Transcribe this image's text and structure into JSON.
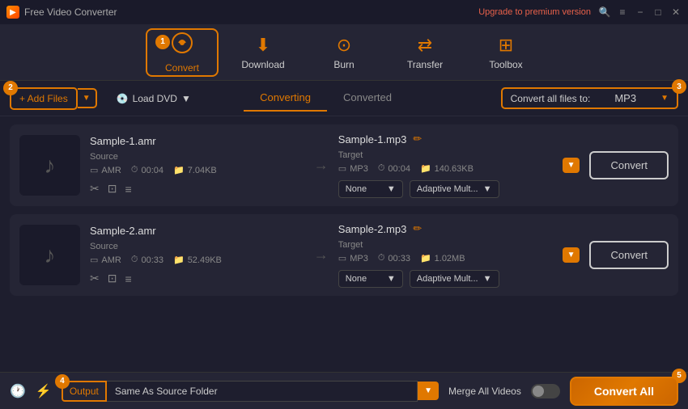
{
  "titlebar": {
    "title": "Free Video Converter",
    "upgrade_text": "Upgrade to premium version",
    "icon": "▶"
  },
  "toolbar": {
    "items": [
      {
        "id": "convert",
        "label": "Convert",
        "icon": "↻",
        "badge": "1",
        "active": true
      },
      {
        "id": "download",
        "label": "Download",
        "icon": "⬇",
        "active": false
      },
      {
        "id": "burn",
        "label": "Burn",
        "icon": "⊙",
        "active": false
      },
      {
        "id": "transfer",
        "label": "Transfer",
        "icon": "⇄",
        "active": false
      },
      {
        "id": "toolbox",
        "label": "Toolbox",
        "icon": "⊞",
        "active": false
      }
    ]
  },
  "subtoolbar": {
    "add_files_label": "+ Add Files",
    "load_dvd_label": "Load DVD",
    "tabs": [
      {
        "label": "Converting",
        "active": true
      },
      {
        "label": "Converted",
        "active": false
      }
    ],
    "convert_all_label": "Convert all files to:",
    "format": "MP3",
    "badge_num": "3"
  },
  "files": [
    {
      "id": "file1",
      "source_name": "Sample-1.amr",
      "source_format": "AMR",
      "source_duration": "00:04",
      "source_size": "7.04KB",
      "target_name": "Sample-1.mp3",
      "target_format": "MP3",
      "target_duration": "00:04",
      "target_size": "140.63KB",
      "effect1": "None",
      "effect2": "Adaptive Mult...",
      "convert_label": "Convert"
    },
    {
      "id": "file2",
      "source_name": "Sample-2.amr",
      "source_format": "AMR",
      "source_duration": "00:33",
      "source_size": "52.49KB",
      "target_name": "Sample-2.mp3",
      "target_format": "MP3",
      "target_duration": "00:33",
      "target_size": "1.02MB",
      "effect1": "None",
      "effect2": "Adaptive Mult...",
      "convert_label": "Convert"
    }
  ],
  "bottombar": {
    "output_label": "Output",
    "output_path": "Same As Source Folder",
    "merge_label": "Merge All Videos",
    "convert_all_label": "Convert All",
    "badge_num4": "4",
    "badge_num5": "5"
  },
  "source_label": "Source",
  "target_label": "Target"
}
